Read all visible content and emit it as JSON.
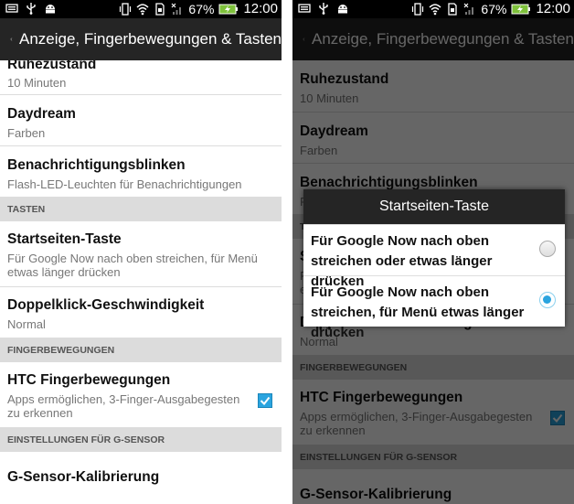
{
  "status": {
    "battery": "67%",
    "time": "12:00"
  },
  "actionbar": {
    "title": "Anzeige, Fingerbewegungen & Tasten"
  },
  "settings": {
    "sleep": {
      "title": "Ruhezustand",
      "value": "10 Minuten"
    },
    "daydream": {
      "title": "Daydream",
      "value": "Farben"
    },
    "notify_led": {
      "title": "Benachrichtigungsblinken",
      "value": "Flash-LED-Leuchten für Benachrichtigungen"
    },
    "cat_keys": "TASTEN",
    "home_key": {
      "title": "Startseiten-Taste",
      "value": "Für Google Now nach oben streichen, für Menü etwas länger drücken"
    },
    "double_click": {
      "title": "Doppelklick-Geschwindigkeit",
      "value": "Normal"
    },
    "cat_gestures": "FINGERBEWEGUNGEN",
    "htc_gestures": {
      "title": "HTC Fingerbewegungen",
      "value": "Apps ermöglichen, 3-Finger-Ausgabegesten zu erkennen",
      "checked": true
    },
    "cat_gsensor": "EINSTELLUNGEN FÜR G-SENSOR",
    "gsensor": {
      "title": "G-Sensor-Kalibrierung"
    }
  },
  "dialog": {
    "title": "Startseiten-Taste",
    "options": [
      {
        "label": "Für Google Now nach oben streichen oder etwas länger drücken",
        "selected": false
      },
      {
        "label": "Für Google Now nach oben streichen, für Menü etwas länger drücken",
        "selected": true
      }
    ]
  },
  "colors": {
    "accent": "#2aa4df",
    "actionbar": "#252525",
    "battery": "#7ec13b"
  }
}
